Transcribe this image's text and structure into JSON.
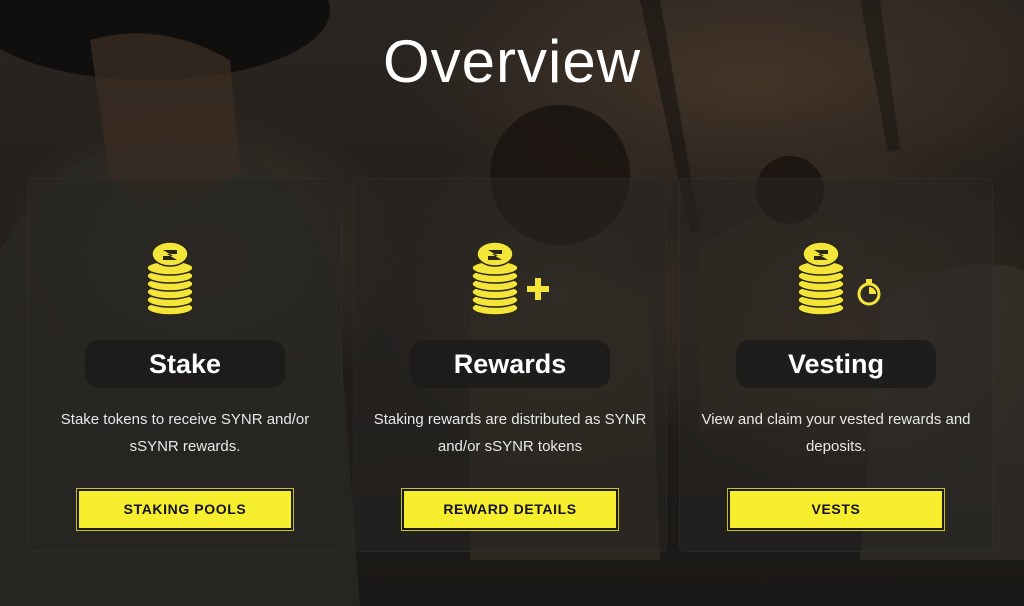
{
  "page": {
    "title": "Overview"
  },
  "cards": [
    {
      "heading": "Stake",
      "description": "Stake tokens to receive SYNR and/or sSYNR rewards.",
      "button_label": "STAKING POOLS",
      "icon": "coin-stack-icon"
    },
    {
      "heading": "Rewards",
      "description": "Staking rewards are distributed as SYNR and/or sSYNR tokens",
      "button_label": "REWARD DETAILS",
      "icon": "coin-stack-plus-icon"
    },
    {
      "heading": "Vesting",
      "description": "View and claim your vested rewards and deposits.",
      "button_label": "VESTS",
      "icon": "coin-stack-timer-icon"
    }
  ],
  "colors": {
    "accent_yellow": "#f7ef2d",
    "text_white": "#ffffff",
    "card_bg": "#282624"
  }
}
